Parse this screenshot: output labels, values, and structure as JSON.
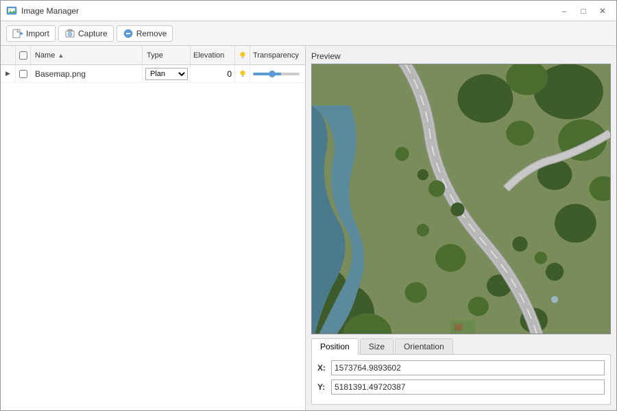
{
  "window": {
    "title": "Image Manager",
    "title_icon": "image-manager-icon"
  },
  "titlebar_buttons": {
    "minimize": "–",
    "maximize": "□",
    "close": "✕"
  },
  "toolbar": {
    "import_label": "Import",
    "capture_label": "Capture",
    "remove_label": "Remove"
  },
  "table": {
    "columns": {
      "name": "Name",
      "type": "Type",
      "elevation": "Elevation",
      "transparency": "Transparency"
    },
    "rows": [
      {
        "name": "Basemap.png",
        "type": "Plan",
        "elevation": "0",
        "transparency_value": 40
      }
    ]
  },
  "preview": {
    "label": "Preview"
  },
  "tabs": [
    {
      "id": "position",
      "label": "Position",
      "active": true
    },
    {
      "id": "size",
      "label": "Size",
      "active": false
    },
    {
      "id": "orientation",
      "label": "Orientation",
      "active": false
    }
  ],
  "position_tab": {
    "x_label": "X:",
    "x_value": "1573764.9893602",
    "y_label": "Y:",
    "y_value": "5181391.49720387"
  }
}
